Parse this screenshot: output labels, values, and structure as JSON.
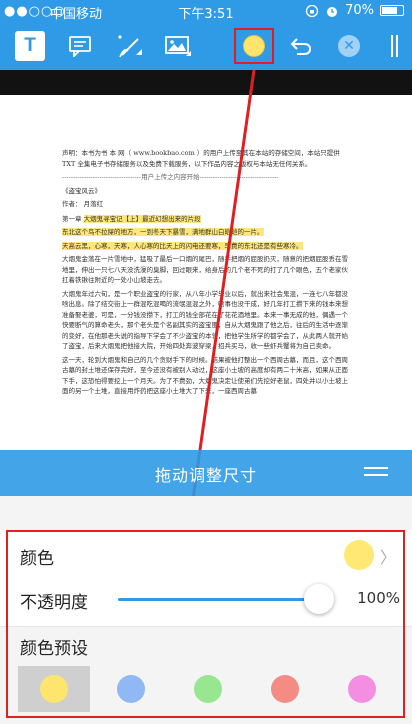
{
  "status_bar": {
    "signal": "●●○○○",
    "carrier": "中国移动",
    "time": "下午3:51",
    "battery": "70%"
  },
  "toolbar": {
    "text_tool": "T",
    "selected_color": "#ffe46b",
    "close_symbol": "✕",
    "icons": [
      "text-icon",
      "comment-icon",
      "pen-icon",
      "image-icon",
      "color-icon",
      "undo-icon",
      "close-icon",
      "more-icon"
    ]
  },
  "document": {
    "notice": "声明：本书为书 本 网（ www.bookbao.com ）的用户上传至其在本站的存储空间，本站只提供 TXT 全集电子书存储服务以及免费下载服务，以下作品内容之版权与本站无任何关",
    "notice_end": "系。",
    "divider": "------------------------------------用户上传之内容开始------------------------------------",
    "book_title": "《盗宝风云》",
    "author": "作者：  月落红",
    "chapter_label": "第一章",
    "highlight_1": "大烟鬼寻宝记【上】最近幻想出来的片段",
    "highlight_2": "东北这个鸟不拉屎的地方，一到冬天下暴雪，满地群山白皑皑的一片。",
    "highlight_3": "天高云黑，心寒，天寒，人心寒的比天上的闪电还要寒，早费的东北还是有些寒冷。",
    "para_1": "大烟鬼金落在一片雪地中，猛吸了最后一口烟的尾巴，随手把烟的屁股扔灭，随意的把烟屁股丢在雪地里，伸出一只七八天没洗澡的臭脚，回过眼来，给身后的几个老不死的打了几个眼色，五个老家伙扛着铁锹往附近的一处小山坡走去。",
    "para_2": "大烟鬼年过六旬，是一个职业盗宝的行家，从八年小学毕业以后，就出来社会鬼混，一连七八年都没啥出息。除了结交街上一群混吃混喝的流氓混混之外，啥事也没干成，好几年打工攒下来的钱本来想准备娶老婆，可是，一分钱没攒下，打工的钱全部花在了花花酒地里。本来一事无成的他，偶遇一个快要断气的算命老头，那个老头是个名副其实的盗宝匪，自从大烟鬼跟了他之后，往后的生活中逐渐的变好，在他那老头说的指导下学会了不少盗宝的本领，把他学生所学的都学会了，从此两人就开始了盗宝，后来大烟鬼把他接大院，开始四处奔波穿梁，招兵买马，收一些虾兵蟹将为自己卖命。",
    "para_3": "这一天，轮到大烟鬼和自己的几个贪财手下的时候。结果被他打整出一个西周古墓，而且，这个西周古墓的封土堆还保存完好，至今还没有被别人动过，这座小土坡的高度却有两二十米高，如果从正面下手，这恐怕得要挖上一个月天。为了不费劲，大烟鬼决定让使弟们先挖好老鼠，四处并以小土坡上面的另一个土堆，直接用炸药把这座小土堆大了下来，一座西周古墓"
  },
  "drag_bar": {
    "label": "拖动调整尺寸",
    "menu_icon": "menu-icon"
  },
  "settings": {
    "color_label": "颜色",
    "current_color": "#ffe873",
    "chevron": "〉",
    "opacity_label": "不透明度",
    "opacity_value": "100%",
    "opacity_fraction": 1.0,
    "preset_label": "颜色预设",
    "presets": [
      {
        "color": "#fde56e",
        "selected": true
      },
      {
        "color": "#8fb8f4",
        "selected": false
      },
      {
        "color": "#98e690",
        "selected": false
      },
      {
        "color": "#f48c84",
        "selected": false
      },
      {
        "color": "#f48ee2",
        "selected": false
      }
    ]
  },
  "colors": {
    "accent": "#2f9ae6",
    "highlight": "#ffe67a",
    "annotation_red": "#e02020"
  }
}
